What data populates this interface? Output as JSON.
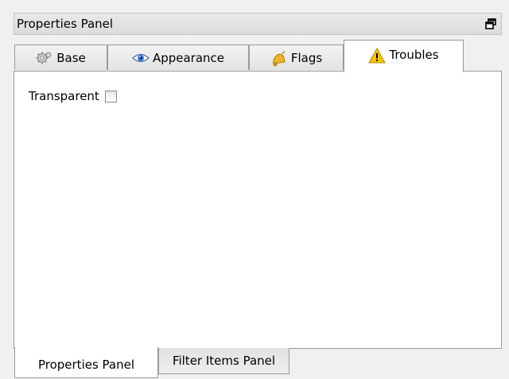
{
  "window": {
    "title": "Properties Panel"
  },
  "tabs": [
    {
      "label": "Base",
      "icon": "gear-icon"
    },
    {
      "label": "Appearance",
      "icon": "eye-icon"
    },
    {
      "label": "Flags",
      "icon": "bell-icon"
    },
    {
      "label": "Troubles",
      "icon": "warning-icon"
    }
  ],
  "selected_tab": "Troubles",
  "content": {
    "transparent_label": "Transparent",
    "transparent_checked": false
  },
  "bottom_tabs": [
    {
      "label": "Properties Panel"
    },
    {
      "label": "Filter Items Panel"
    }
  ],
  "selected_bottom_tab": "Properties Panel",
  "colors": {
    "panel_bg": "#ffffff",
    "window_bg": "#f0f0f0",
    "titlebar": "#dcdcdc",
    "border": "#9a9a9a",
    "warning_yellow": "#f5c400"
  }
}
